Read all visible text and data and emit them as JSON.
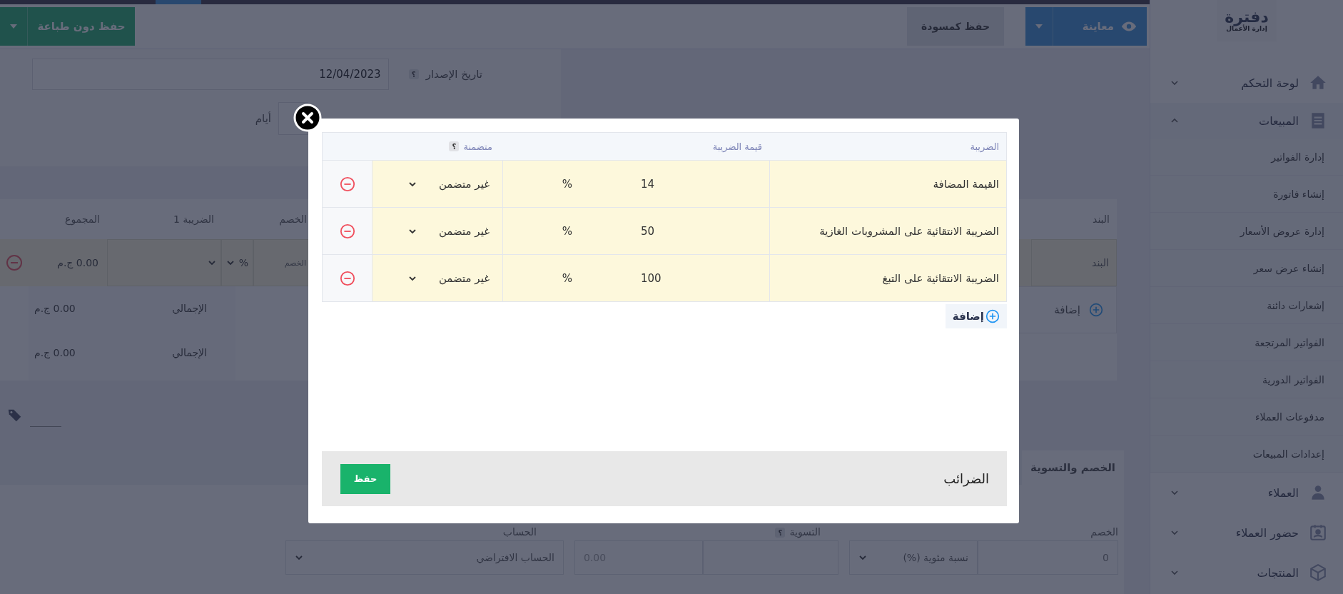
{
  "toolbar": {
    "preview_button": "معاينة",
    "draft_button": "حفظ كمسودة",
    "save_button": "حفظ دون طباعة"
  },
  "sidebar": {
    "logo": "دفترة",
    "tagline": "إدارة الأعمال",
    "items": [
      {
        "label": "لوحة التحكم",
        "expanded": false
      },
      {
        "label": "المبيعات",
        "expanded": true,
        "children": [
          {
            "label": "إدارة الفواتير"
          },
          {
            "label": "إنشاء فاتورة"
          },
          {
            "label": "إدارة عروض الأسعار"
          },
          {
            "label": "إنشاء عرض سعر"
          },
          {
            "label": "إشعارات دائنة"
          },
          {
            "label": "الفواتير المرتجعة"
          },
          {
            "label": "الفواتير الدورية"
          },
          {
            "label": "مدفوعات العملاء"
          },
          {
            "label": "إعدادات المبيعات"
          }
        ]
      },
      {
        "label": "العملاء",
        "expanded": false
      },
      {
        "label": "حضور العملاء",
        "expanded": false
      },
      {
        "label": "المنتجات",
        "expanded": false
      }
    ]
  },
  "form": {
    "issue_date": {
      "label": "تاريخ الإصدار",
      "help": "؟",
      "value": "12/04/2023"
    },
    "terms": {
      "unit": "أيام"
    }
  },
  "items_table": {
    "columns": [
      "البند",
      "الخصم",
      "الضريبة 1",
      "المجموع"
    ],
    "row": {
      "item_placeholder": "البند",
      "discount_placeholder": "الخصم",
      "discount_type": "%",
      "total": "0.00 ج.م"
    },
    "add_button": "إضافة",
    "totals": [
      {
        "label": "الإجمالي",
        "value": "0.00 ج.م"
      },
      {
        "label": "الإجمالي",
        "value": "0.00 ج.م"
      }
    ]
  },
  "bottom": {
    "tabs": [
      {
        "label": "الخصم والتسوية",
        "selected": true
      }
    ],
    "discount_label": "الخصم",
    "adjustment_label": "التسوية",
    "adjustment_help": "؟",
    "account_label": "الحساب",
    "discount_value": "0",
    "discount_type": "نسبة مئوية (%)",
    "adjustment_value": "0.00",
    "account": "الحساب الافتراضي"
  },
  "modal": {
    "columns": [
      "الضريبة",
      "قيمة الضريبة",
      "متضمنة"
    ],
    "included_help": "؟",
    "rows": [
      {
        "name": "القيمة المضافة",
        "value": "14",
        "unit": "%",
        "included": "غير متضمن"
      },
      {
        "name": "الضريبة الانتقائية على المشروبات الغازية",
        "value": "50",
        "unit": "%",
        "included": "غير متضمن"
      },
      {
        "name": "الضريبة الانتقائية على التبغ",
        "value": "100",
        "unit": "%",
        "included": "غير متضمن"
      }
    ],
    "add_button": "إضافة",
    "title": "الضرائب",
    "save_button": "حفظ"
  }
}
